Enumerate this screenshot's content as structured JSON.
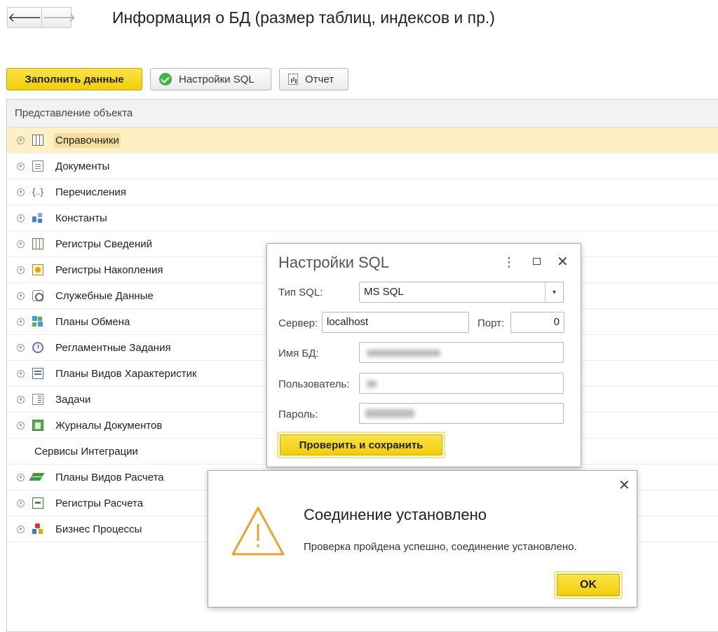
{
  "header": {
    "back_icon": "arrow-left-icon",
    "forward_icon": "arrow-right-icon",
    "back_glyph": "🡐",
    "forward_glyph": "🡒",
    "title": "Информация о БД (размер таблиц, индексов и пр.)"
  },
  "toolbar": {
    "fill_label": "Заполнить данные",
    "sql_settings_label": "Настройки SQL",
    "report_label": "Отчет",
    "accent_color": "#f2cd06"
  },
  "tree": {
    "column_header": "Представление объекта",
    "rows": [
      {
        "label": "Справочники",
        "icon": "catalog-icon",
        "expandable": true,
        "selected": true
      },
      {
        "label": "Документы",
        "icon": "document-icon",
        "expandable": true
      },
      {
        "label": "Перечисления",
        "icon": "enum-icon",
        "expandable": true
      },
      {
        "label": "Константы",
        "icon": "constants-icon",
        "expandable": true
      },
      {
        "label": "Регистры Сведений",
        "icon": "info-register-icon",
        "expandable": true
      },
      {
        "label": "Регистры Накопления",
        "icon": "accumulation-register-icon",
        "expandable": true
      },
      {
        "label": "Служебные Данные",
        "icon": "service-data-icon",
        "expandable": true
      },
      {
        "label": "Планы Обмена",
        "icon": "exchange-plan-icon",
        "expandable": true
      },
      {
        "label": "Регламентные Задания",
        "icon": "scheduled-job-icon",
        "expandable": true
      },
      {
        "label": "Планы Видов Характеристик",
        "icon": "chart-of-characteristics-icon",
        "expandable": true
      },
      {
        "label": "Задачи",
        "icon": "task-icon",
        "expandable": true
      },
      {
        "label": "Журналы Документов",
        "icon": "document-journal-icon",
        "expandable": true
      },
      {
        "label": "Сервисы Интеграции",
        "icon": "",
        "expandable": false
      },
      {
        "label": "Планы Видов Расчета",
        "icon": "calculation-types-icon",
        "expandable": true
      },
      {
        "label": "Регистры Расчета",
        "icon": "calculation-register-icon",
        "expandable": true
      },
      {
        "label": "Бизнес Процессы",
        "icon": "business-process-icon",
        "expandable": true
      }
    ]
  },
  "sql_dialog": {
    "title": "Настройки SQL",
    "menu_glyph": "⋮",
    "close_glyph": "✕",
    "sql_type_label": "Тип SQL:",
    "sql_type_value": "MS SQL",
    "dropdown_glyph": "▾",
    "server_label": "Сервер:",
    "server_value": "localhost",
    "port_label": "Порт:",
    "port_value": "0",
    "db_name_label": "Имя БД:",
    "user_label": "Пользователь:",
    "password_label": "Пароль:",
    "save_button": "Проверить и сохранить"
  },
  "message_dialog": {
    "close_glyph": "✕",
    "icon": "warning-triangle-icon",
    "title": "Соединение установлено",
    "text": "Проверка пройдена успешно, соединение установлено.",
    "ok_button": "OK",
    "warning_color": "#f0a030"
  }
}
